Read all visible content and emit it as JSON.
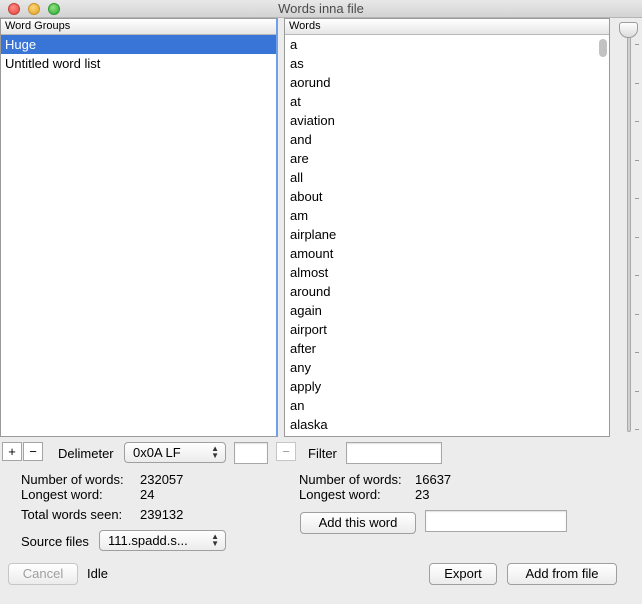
{
  "window": {
    "title": "Words inna file"
  },
  "groups": {
    "header": "Word Groups",
    "items": [
      {
        "label": "Huge",
        "selected": true
      },
      {
        "label": "Untitled word list",
        "selected": false
      }
    ]
  },
  "words": {
    "header": "Words",
    "items": [
      "a",
      "as",
      "aorund",
      "at",
      "aviation",
      "and",
      "are",
      "all",
      "about",
      "am",
      "airplane",
      "amount",
      "almost",
      "around",
      "again",
      "airport",
      "after",
      "any",
      "apply",
      "an",
      "alaska"
    ]
  },
  "controls": {
    "add_label": "+",
    "remove_label": "−",
    "remove_word_label": "−",
    "delimiter_label": "Delimeter",
    "delimiter_value": "0x0A LF",
    "delimiter_custom_value": "",
    "filter_label": "Filter",
    "filter_value": "",
    "source_files_label": "Source files",
    "source_files_value": "111.spadd.s...",
    "add_this_word_label": "Add this word",
    "add_word_value": "",
    "cancel_label": "Cancel",
    "status": "Idle",
    "export_label": "Export",
    "add_from_file_label": "Add from file"
  },
  "stats_left": {
    "number_of_words_label": "Number of words:",
    "number_of_words": "232057",
    "longest_word_label": "Longest word:",
    "longest_word": "24",
    "total_words_seen_label": "Total words seen:",
    "total_words_seen": "239132"
  },
  "stats_right": {
    "number_of_words_label": "Number of words:",
    "number_of_words": "16637",
    "longest_word_label": "Longest word:",
    "longest_word": "23"
  }
}
